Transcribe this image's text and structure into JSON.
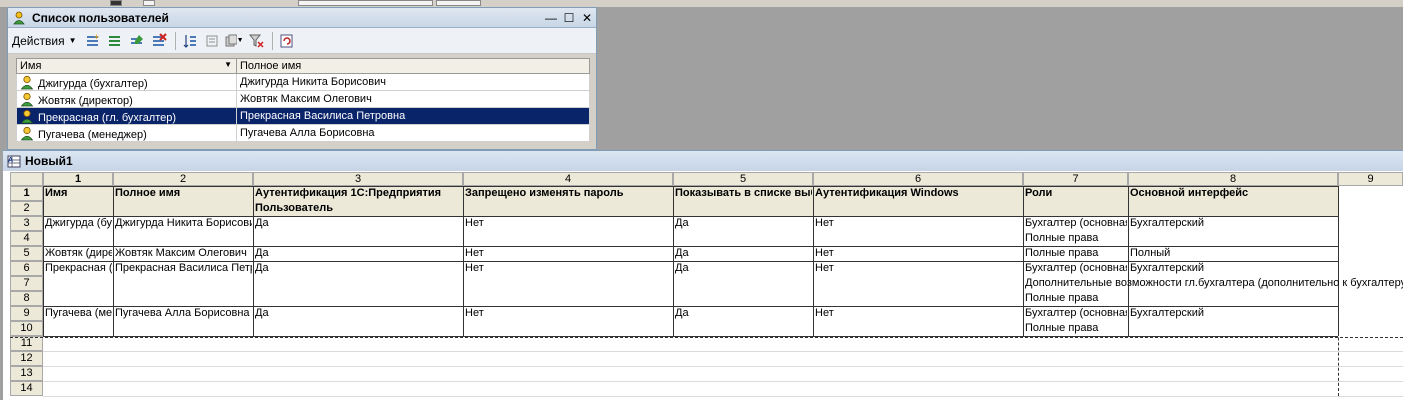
{
  "user_window": {
    "title": "Список пользователей",
    "actions_label": "Действия",
    "columns": [
      "Имя",
      "Полное имя"
    ],
    "rows": [
      {
        "name": "Джигурда (бухгалтер)",
        "full": "Джигурда Никита Борисович",
        "selected": false
      },
      {
        "name": "Жовтяк (директор)",
        "full": "Жовтяк Максим Олегович",
        "selected": false
      },
      {
        "name": "Прекрасная (гл. бухгалтер)",
        "full": "Прекрасная Василиса Петровна",
        "selected": true
      },
      {
        "name": "Пугачева (менеджер)",
        "full": "Пугачева Алла Борисовна",
        "selected": false
      }
    ]
  },
  "sheet_window": {
    "title": "Новый1",
    "col_headers": [
      "1",
      "2",
      "3",
      "4",
      "5",
      "6",
      "7",
      "8",
      "9"
    ],
    "row_headers": [
      "1",
      "2",
      "3",
      "4",
      "5",
      "6",
      "7",
      "8",
      "9",
      "10",
      "11",
      "12",
      "13",
      "14"
    ],
    "header_row": [
      "Имя",
      "Полное имя",
      "Аутентификация 1С:Предприятия",
      "Запрещено изменять пароль",
      "Показывать в списке выбора",
      "Аутентификация Windows",
      "Роли",
      "Основной интерфейс"
    ],
    "header_row2_col3": "Пользователь",
    "data": [
      {
        "row": 3,
        "cells": [
          "Джигурда (бухгалтер)",
          "Джигурда Никита Борисович",
          "Да",
          "Нет",
          "Да",
          "Нет",
          "Бухгалтер (основная)",
          "Бухгалтерский"
        ]
      },
      {
        "row": 4,
        "cells": [
          "",
          "",
          "",
          "",
          "",
          "",
          "Полные права",
          ""
        ]
      },
      {
        "row": 5,
        "cells": [
          "Жовтяк (директор)",
          "Жовтяк Максим Олегович",
          "Да",
          "Нет",
          "Да",
          "Нет",
          "Полные права",
          "Полный"
        ]
      },
      {
        "row": 6,
        "cells": [
          "Прекрасная (гл. бухгалтер)",
          "Прекрасная Василиса Петровна",
          "Да",
          "Нет",
          "Да",
          "Нет",
          "Бухгалтер (основная)",
          "Бухгалтерский"
        ]
      },
      {
        "row": 7,
        "cells": [
          "",
          "",
          "",
          "",
          "",
          "",
          "Дополнительные возможности гл.бухгалтера (дополнительно к бухгалтеру)",
          ""
        ]
      },
      {
        "row": 8,
        "cells": [
          "",
          "",
          "",
          "",
          "",
          "",
          "Полные права",
          ""
        ]
      },
      {
        "row": 9,
        "cells": [
          "Пугачева (менеджер)",
          "Пугачева Алла Борисовна",
          "Да",
          "Нет",
          "Да",
          "Нет",
          "Бухгалтер (основная)",
          "Бухгалтерский"
        ]
      },
      {
        "row": 10,
        "cells": [
          "",
          "",
          "",
          "",
          "",
          "",
          "Полные права",
          ""
        ]
      }
    ]
  },
  "colors": {
    "selection": "#0a246a",
    "header_bg": "#ece9d8",
    "title_bg": "#c8d6e6"
  }
}
